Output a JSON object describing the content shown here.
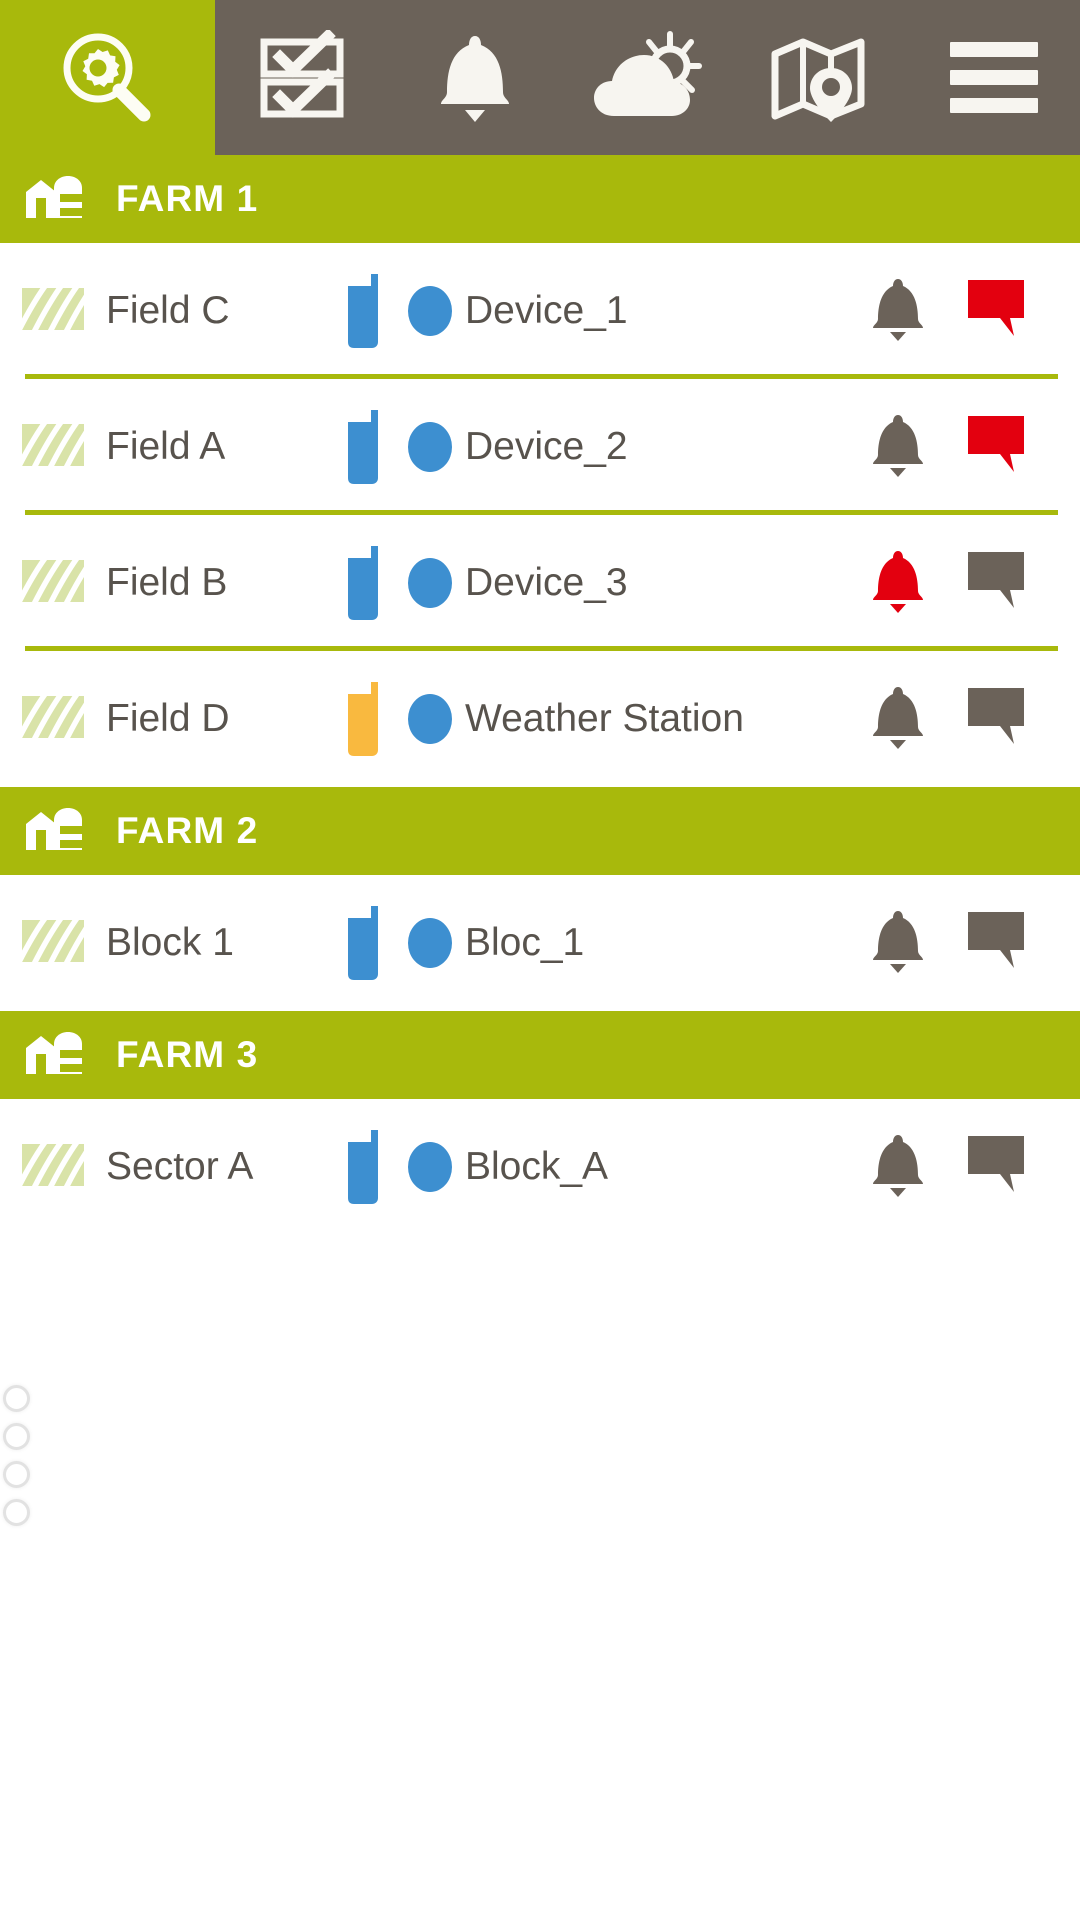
{
  "app": {
    "accent_olive": "#a8b90c",
    "toolbar_brown": "#6b6259",
    "alert_red": "#e3000f",
    "device_blue": "#3d8fd0",
    "battery_low_orange": "#f9b93f",
    "text_gray": "#58534d",
    "field_icon_green": "#d9e3a8"
  },
  "toolbar": {
    "search_icon": "search-gear-icon",
    "search_label": "Search",
    "items": [
      {
        "icon": "checklist-icon",
        "label": "Tasks"
      },
      {
        "icon": "bell-icon",
        "label": "Alarms"
      },
      {
        "icon": "cloud-sun-icon",
        "label": "Weather"
      },
      {
        "icon": "map-pin-icon",
        "label": "Map"
      },
      {
        "icon": "hamburger-menu-icon",
        "label": "Menu"
      }
    ]
  },
  "farms": [
    {
      "name": "FARM 1",
      "icon": "barn-icon",
      "rows": [
        {
          "field": "Field C",
          "field_icon": "field-furrow-icon",
          "device": "Device_1",
          "battery_color": "#3d8fd0",
          "battery_state": "ok",
          "status_dot_color": "#3d8fd0",
          "bell_color": "#6b6259",
          "bell_state": "inactive",
          "message_color": "#e3000f",
          "message_state": "active",
          "separator": true
        },
        {
          "field": "Field A",
          "field_icon": "field-furrow-icon",
          "device": "Device_2",
          "battery_color": "#3d8fd0",
          "battery_state": "ok",
          "status_dot_color": "#3d8fd0",
          "bell_color": "#6b6259",
          "bell_state": "inactive",
          "message_color": "#e3000f",
          "message_state": "active",
          "separator": true
        },
        {
          "field": "Field B",
          "field_icon": "field-furrow-icon",
          "device": "Device_3",
          "battery_color": "#3d8fd0",
          "battery_state": "ok",
          "status_dot_color": "#3d8fd0",
          "bell_color": "#e3000f",
          "bell_state": "active",
          "message_color": "#6b6259",
          "message_state": "inactive",
          "separator": true
        },
        {
          "field": "Field D",
          "field_icon": "field-furrow-icon",
          "device": "Weather Station",
          "battery_color": "#f9b93f",
          "battery_state": "low",
          "status_dot_color": "#3d8fd0",
          "bell_color": "#6b6259",
          "bell_state": "inactive",
          "message_color": "#6b6259",
          "message_state": "inactive",
          "separator": false
        }
      ]
    },
    {
      "name": "FARM 2",
      "icon": "barn-icon",
      "rows": [
        {
          "field": "Block 1",
          "field_icon": "field-furrow-icon",
          "device": "Bloc_1",
          "battery_color": "#3d8fd0",
          "battery_state": "ok",
          "status_dot_color": "#3d8fd0",
          "bell_color": "#6b6259",
          "bell_state": "inactive",
          "message_color": "#6b6259",
          "message_state": "inactive",
          "separator": false
        }
      ]
    },
    {
      "name": "FARM 3",
      "icon": "barn-icon",
      "rows": [
        {
          "field": "Sector A",
          "field_icon": "field-furrow-icon",
          "device": "Block_A",
          "battery_color": "#3d8fd0",
          "battery_state": "ok",
          "status_dot_color": "#3d8fd0",
          "bell_color": "#6b6259",
          "bell_state": "inactive",
          "message_color": "#6b6259",
          "message_state": "inactive",
          "separator": false
        }
      ]
    }
  ],
  "footer": {
    "pager_dots": 4,
    "dot_icon": "circle-outline-icon"
  }
}
